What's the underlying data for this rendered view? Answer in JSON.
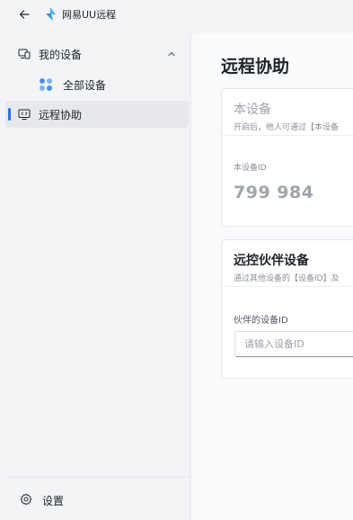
{
  "titlebar": {
    "app_name": "网易UU远程",
    "back_icon": "back-arrow-icon",
    "logo_color": "#2a8cf0"
  },
  "sidebar": {
    "group": {
      "label": "我的设备",
      "icon": "devices-icon",
      "expanded": true
    },
    "items": [
      {
        "label": "全部设备",
        "icon": "grid-dots-icon",
        "selected": false
      },
      {
        "label": "远程协助",
        "icon": "remote-screen-icon",
        "selected": true
      }
    ],
    "settings_label": "设置"
  },
  "main": {
    "title": "远程协助",
    "device_card": {
      "title": "本设备",
      "description": "开启后，他人可通过【本设备",
      "id_label": "本设备ID",
      "id_value": "799 984"
    },
    "partner_card": {
      "title": "远控伙伴设备",
      "description": "通过其他设备的【设备ID】及",
      "input_label": "伙伴的设备ID",
      "input_placeholder": "请输入设备ID",
      "input_value": ""
    }
  },
  "colors": {
    "accent": "#2a6fea",
    "selected_bg": "#e7e8eb"
  }
}
